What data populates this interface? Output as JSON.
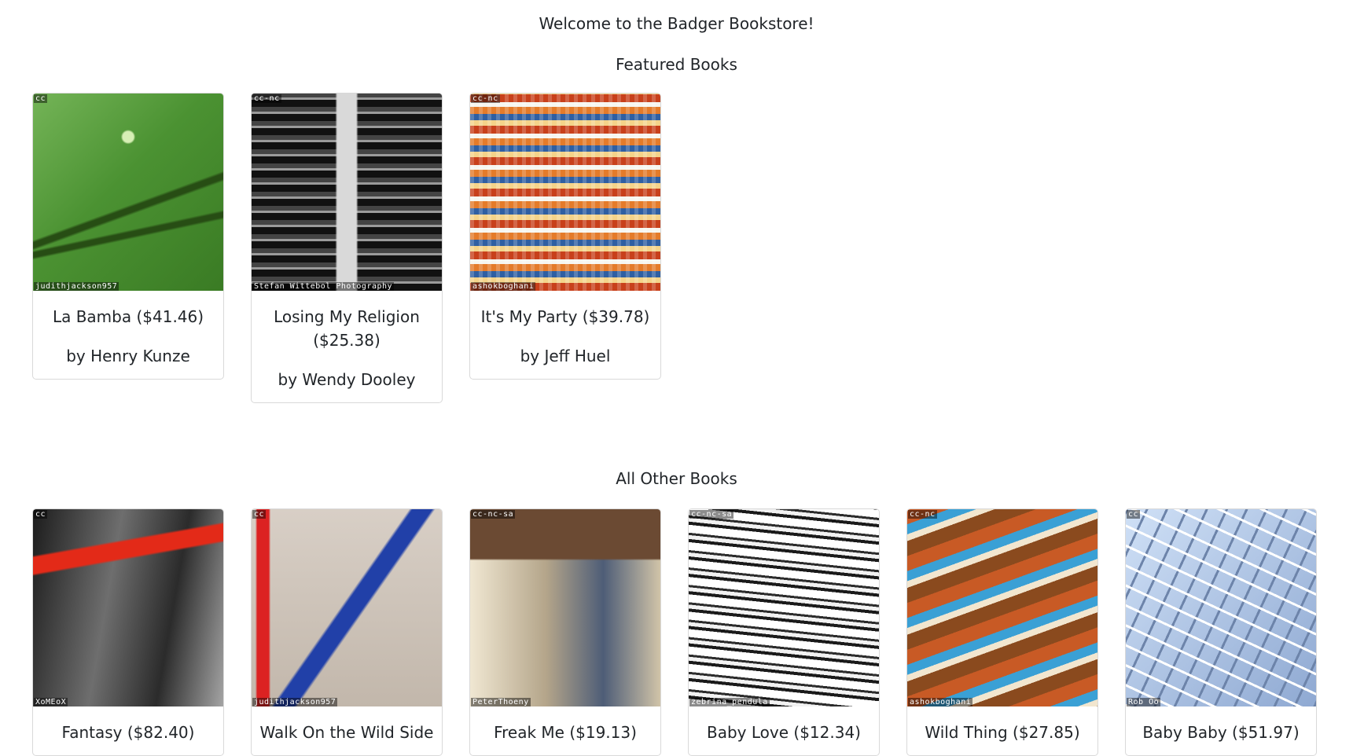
{
  "welcome": "Welcome to the Badger Bookstore!",
  "featured_heading": "Featured Books",
  "other_heading": "All Other Books",
  "featured": [
    {
      "title": "La Bamba ($41.46)",
      "author": "by Henry Kunze",
      "license": "cc",
      "credit": "judithjackson957"
    },
    {
      "title": "Losing My Religion ($25.38)",
      "author": "by Wendy Dooley",
      "license": "cc-nc",
      "credit": "Stefan Wittebol Photography"
    },
    {
      "title": "It's My Party ($39.78)",
      "author": "by Jeff Huel",
      "license": "cc-nc",
      "credit": "ashokboghani"
    }
  ],
  "others": [
    {
      "title": "Fantasy ($82.40)",
      "license": "cc",
      "credit": "XoMEoX"
    },
    {
      "title": "Walk On the Wild Side",
      "license": "cc",
      "credit": "judithjackson957"
    },
    {
      "title": "Freak Me ($19.13)",
      "license": "cc-nc-sa",
      "credit": "PeterThoeny"
    },
    {
      "title": "Baby Love ($12.34)",
      "license": "cc-nc-sa",
      "credit": "zebrina_pendula"
    },
    {
      "title": "Wild Thing ($27.85)",
      "license": "cc-nc",
      "credit": "ashokboghani"
    },
    {
      "title": "Baby Baby ($51.97)",
      "license": "cc",
      "credit": "Rob Oo"
    }
  ]
}
